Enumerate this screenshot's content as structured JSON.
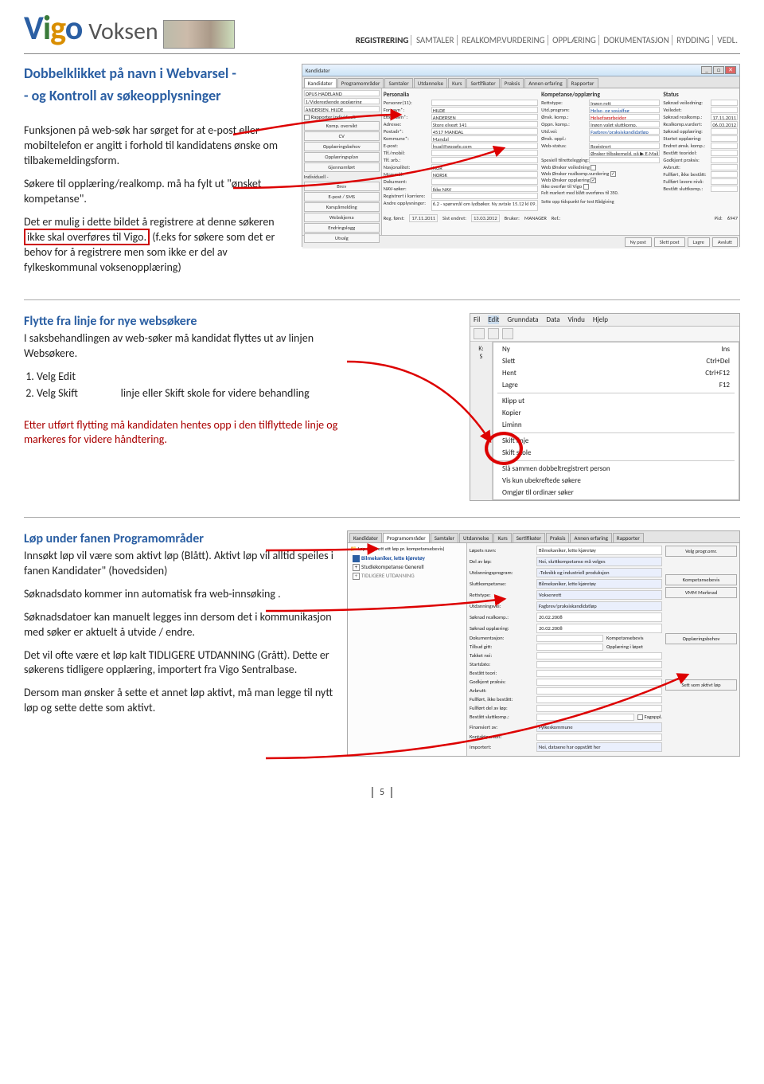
{
  "header": {
    "logo_text_parts": [
      "V",
      "i",
      "g",
      "o"
    ],
    "voksen": "Voksen",
    "tabs": [
      "REGISTRERING",
      "SAMTALER",
      "REALKOMP.VURDERING",
      "OPPLÆRING",
      "DOKUMENTASJON",
      "RYDDING",
      "VEDL."
    ],
    "active_tab": "REGISTRERING"
  },
  "section1": {
    "title_l1": "Dobbelklikket på navn i Webvarsel -",
    "title_l2": "- og   Kontroll av søkeopplysninger",
    "p1": "Funksjonen på web-søk har sørget for at e-post eller mobiltelefon er angitt i forhold til kandidatens ønske om tilbakemeldingsform.",
    "p2": "Søkere til opplæring/realkomp. må ha fylt ut \"ønsket kompetanse\".",
    "p3_pre": "Det er mulig i dette bildet å registrere at denne søkeren ",
    "p3_box": "ikke skal overføres til Vigo.",
    "p3_post": " (f.eks for søkere som det er behov for å registrere men som ikke er del av fylkeskommunal voksenopplæring)"
  },
  "ss1": {
    "window_title": "Kandidater",
    "tabs": [
      "Kandidater",
      "Programområder",
      "Samtaler",
      "Utdannelse",
      "Kurs",
      "Sertifikater",
      "Praksis",
      "Annen erfaring",
      "Rapporter"
    ],
    "side_top": {
      "label": "OPUS HADELAND"
    },
    "side_rows": [
      {
        "label": "1/Videregående opplæring"
      },
      {
        "label": "ANDERSEN, HILDE"
      }
    ],
    "side_checkbox": "Rapporter individuelt",
    "side_buttons": [
      "Komp. oversikt",
      "CV",
      "Opplæringsbehov",
      "Opplæringsplan",
      "Gjennomført",
      "Brev",
      "E-post / SMS",
      "Karspåmelding",
      "Webskjema",
      "Endringslogg",
      "Utvalg"
    ],
    "personalia": {
      "title": "Personalia",
      "rows": [
        {
          "k": "Personnr(11):",
          "v": ""
        },
        {
          "k": "Etternavn*:",
          "v": "ANDERSEN"
        },
        {
          "k": "Fornavn*:",
          "v": "HILDE"
        },
        {
          "k": "Adresse:",
          "v": "Store elvegt 141"
        },
        {
          "k": "Postadr*:",
          "v": "4517  MANDAL"
        },
        {
          "k": "Kommune*:",
          "v": "Mandal"
        },
        {
          "k": "E-post:",
          "v": "hsad@google.com"
        },
        {
          "k": "Tlf./mobil:",
          "v": ""
        },
        {
          "k": "Tlf. arb.:",
          "v": ""
        },
        {
          "k": "Nasjonalitet:",
          "v": "NOR"
        },
        {
          "k": "Morsmål:",
          "v": "NORSK"
        },
        {
          "k": "Dokument:",
          "v": ""
        },
        {
          "k": "NAV-søker:",
          "v": "Ikke NAV"
        },
        {
          "k": "Registrert i karriere:",
          "v": ""
        },
        {
          "k": "Andre opplysninger:",
          "v": "6.2 - spørsmål om lydbøker. Ny avtale 15.12 kl 09."
        }
      ]
    },
    "komp": {
      "title": "Kompetanse/opplæring",
      "rows": [
        {
          "k": "Rettstype:",
          "v": "Ingen rett"
        },
        {
          "k": "Utd.program:",
          "v": "Helse- og sosialfag",
          "cls": "hl-blue"
        },
        {
          "k": "Ønsk. komp.:",
          "v": "Helsefagarbeider",
          "cls": "hl-red"
        },
        {
          "k": "Oppn. komp.:",
          "v": "Ingen valgt sluttkomp."
        },
        {
          "k": "Utd.vei:",
          "v": "Fagbrev/praksiskandidatløp",
          "cls": "hl-blue"
        },
        {
          "k": "Ønsk. oppl.:",
          "v": ""
        },
        {
          "k": "Web-status:",
          "v": "Registrert"
        },
        {
          "k": "",
          "v": "Ønsker tilbakemeld. på ▶  E-Mail"
        },
        {
          "k": "Spesiell tilrettelegging:",
          "v": ""
        },
        {
          "k": "Web Ønsker veiledning",
          "chk": false
        },
        {
          "k": "Web Ønsker realkomp.vurdering",
          "chk": true
        },
        {
          "k": "Web Ønsker opplæring",
          "chk": true
        },
        {
          "k": "Ikke overfør til Vigo",
          "chk": false
        },
        {
          "k": "Felt markert med blått overføres til 350.",
          "plain": true
        }
      ]
    },
    "status": {
      "title": "Status",
      "rows": [
        {
          "k": "Søknad veiledning:",
          "v": ""
        },
        {
          "k": "Veiledet:",
          "v": ""
        },
        {
          "k": "Søknad realkomp.:",
          "v": "17.11.2011"
        },
        {
          "k": "Realkomp.vurdert:",
          "v": "06.03.2012"
        },
        {
          "k": "Søknad opplæring:",
          "v": ""
        },
        {
          "k": "Startet opplæring:",
          "v": ""
        },
        {
          "k": "Endret ønsk. komp.:",
          "v": ""
        },
        {
          "k": "Bestått teoridel:",
          "v": ""
        },
        {
          "k": "Godkjent praksis:",
          "v": ""
        },
        {
          "k": "Avbrutt:",
          "v": ""
        },
        {
          "k": "Fullført, ikke bestått:",
          "v": ""
        },
        {
          "k": "Fullført lavere nivå:",
          "v": ""
        },
        {
          "k": "Bestått sluttkomp.:",
          "v": ""
        }
      ]
    },
    "infoline": "Sette opp tidspunkt for test Rådgiving",
    "footer": {
      "reg": "Reg. først:",
      "reg_v": "17.11.2011",
      "sist": "Sist endret:",
      "sist_v": "13.03.2012",
      "bruker": "Bruker:",
      "bruker_v": "MANAGER",
      "ref": "Ref.:",
      "ref_v": "",
      "pid": "Pid:",
      "pid_v": "6947"
    },
    "bottom_buttons": [
      "Ny post",
      "Slett post",
      "Lagre",
      "Avslutt"
    ],
    "individ_label": "Individuell -"
  },
  "section2": {
    "title": "Flytte fra linje for nye websøkere",
    "p1": "I saksbehandlingen av  web-søker må kandidat flyttes ut av linjen Websøkere.",
    "li1": "Velg Edit",
    "li2_a": "Velg Skift",
    "li2_b": "linje eller Skift skole for videre behandling",
    "red": "Etter utført flytting må kandidaten hentes opp i den tilflyttede linje og markeres for videre håndtering."
  },
  "ctx": {
    "menubar": [
      "Fil",
      "Edit",
      "Grunndata",
      "Data",
      "Vindu",
      "Hjelp"
    ],
    "items": [
      {
        "label": "Ny",
        "short": "Ins"
      },
      {
        "label": "Slett",
        "short": "Ctrl+Del"
      },
      {
        "label": "Hent",
        "short": "Ctrl+F12"
      },
      {
        "label": "Lagre",
        "short": "F12"
      },
      {
        "sep": true
      },
      {
        "label": "Klipp ut"
      },
      {
        "label": "Kopier"
      },
      {
        "label": "Liminn"
      },
      {
        "sep": true
      },
      {
        "label": "Skift linje"
      },
      {
        "label": "Skift skole"
      },
      {
        "sep": true
      },
      {
        "label": "Slå sammen dobbeltregistrert person"
      },
      {
        "label": "Vis kun ubekreftede søkere"
      },
      {
        "label": "Omgjør til ordinær søker"
      }
    ]
  },
  "section3": {
    "title": "Løp under fanen Programområder",
    "p1": "Innsøkt løp vil være som aktivt løp (Blått). Aktivt løp vil alltid speiles i fanen Kandidater\" (hovedsiden)",
    "p2": "Søknadsdato kommer inn automatisk fra web-innsøking .",
    "p3": "Søknadsdatoer kan manuelt legges inn dersom det i kommunikasjon med søker er aktuelt å utvide / endre.",
    "p4": "Det vil ofte være et løp kalt TIDLIGERE UTDANNING (Grått). Dette er søkerens tidligere opplæring, importert fra Vigo Sentralbase.",
    "p5": "Dersom man ønsker å sette et annet løp aktivt, må man legge til nytt løp og sette dette som aktivt."
  },
  "prog": {
    "tabs": [
      "Kandidater",
      "Programområder",
      "Samtaler",
      "Utdannelse",
      "Kurs",
      "Sertifikater",
      "Praksis",
      "Annen erfaring",
      "Rapporter"
    ],
    "tree_header": "Løp (opprett ett løp pr. kompetansebevis)",
    "tree": [
      {
        "label": "Bilmekaniker, lette kjøretøy",
        "blue": true,
        "dot": true
      },
      {
        "label": "Studiekompetanse Generell",
        "plus": true
      },
      {
        "label": "TIDLIGERE UTDANNING",
        "plus": true,
        "grey": true
      }
    ],
    "right_rows": [
      {
        "k": "Løpets navn:",
        "v": "Bilmekaniker, lette kjøretøy"
      },
      {
        "k": "Del av løp:",
        "v": "Nei, sluttkompetanse må velges",
        "sel": true
      },
      {
        "k": "Utdanningsprogram:",
        "v": "-Teknikk og industriell produksjon",
        "sel": true
      },
      {
        "k": "Sluttkompetanse:",
        "v": "Bilmekaniker, lette kjøretøy",
        "sel": true
      },
      {
        "k": "Rettstype:",
        "v": "Voksenrett",
        "sel": true
      },
      {
        "k": "Utdanningsvei:",
        "v": "Fagbrev/praksiskandidatløp",
        "sel": true
      },
      {
        "k": "Søknad realkomp.:",
        "v": "20.02.2008"
      },
      {
        "k": "Søknad opplæring:",
        "v": "20.02.2008"
      },
      {
        "k": "Dokumentasjon:",
        "v": ""
      },
      {
        "k": "Tilbud gitt:",
        "v": ""
      },
      {
        "k": "Takket nei:",
        "v": ""
      },
      {
        "k": "Startdato:",
        "v": ""
      },
      {
        "k": "Bestått teori:",
        "v": ""
      },
      {
        "k": "Godkjent praksis:",
        "v": ""
      },
      {
        "k": "Avbrutt:",
        "v": ""
      },
      {
        "k": "Fullført, ikke bestått:",
        "v": ""
      },
      {
        "k": "Fullført del av løp:",
        "v": ""
      },
      {
        "k": "Bestått sluttkomp.:",
        "v": "",
        "extra_chk": "Fagoppl."
      },
      {
        "k": "Finansiert av:",
        "v": "Fylkeskommune",
        "sel": true
      },
      {
        "k": "Kontaktperson:",
        "v": ""
      },
      {
        "k": "Importert:",
        "v": "Nei, dataene har oppstått her",
        "sel": true
      }
    ],
    "side_labels": {
      "komp": "Kompetansebevis",
      "oppl": "Opplæring i løpet"
    },
    "side_buttons": [
      "Velg progr.omr.",
      "Kompetansebevis",
      "VMM Merknad",
      "Opplæringsbehov",
      "Sett som aktivt løp"
    ]
  },
  "page_number": "5"
}
